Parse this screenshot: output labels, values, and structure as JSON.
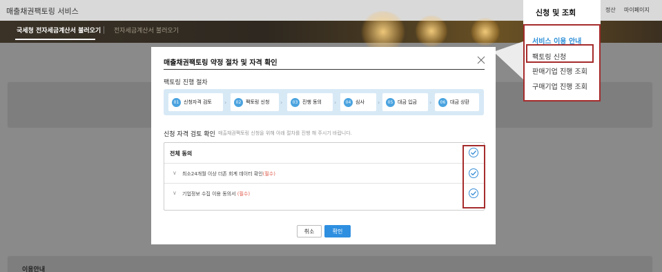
{
  "header": {
    "brand": "매출채권팩토링 서비스",
    "nav_settle": "정산",
    "nav_mypage": "마이페이지"
  },
  "banner": {
    "tab_active": "국세청 전자세금계산서 불러오기",
    "tab_inactive": "전자세금계산서 불러오기"
  },
  "background": {
    "info_title": "이용안내"
  },
  "menu": {
    "title": "신청 및 조회",
    "items": [
      {
        "label": "서비스 이용 안내"
      },
      {
        "label": "팩토링 신청"
      },
      {
        "label": "판매기업 진행 조회"
      },
      {
        "label": "구매기업 진행 조회"
      }
    ]
  },
  "modal": {
    "title": "매출채권팩토링 약정 절차 및 자격 확인",
    "process_label": "팩토링 진행 절차",
    "steps": [
      {
        "num": "01",
        "label": "신청자격 검토"
      },
      {
        "num": "02",
        "label": "팩토링 신청"
      },
      {
        "num": "03",
        "label": "진행 동의"
      },
      {
        "num": "04",
        "label": "심사"
      },
      {
        "num": "05",
        "label": "대금 입금"
      },
      {
        "num": "06",
        "label": "대금 상환"
      }
    ],
    "check_title": "신청 자격 검토 확인",
    "check_sub": "매출채권팩토링 신청을 위해 아래 절차를 진행 해 주시기 바랍니다.",
    "agree_all": "전체 동의",
    "agree_items": [
      {
        "label": "최소24개월 이상 더존 회계 데이터 확인",
        "required": "(필수)"
      },
      {
        "label": "기업정보 수집 이용 동의서",
        "required": "(필수)"
      }
    ],
    "cancel_label": "취소",
    "ok_label": "확인"
  },
  "colors": {
    "accent": "#2e8fe0",
    "highlight_border": "#a52a2a",
    "required": "#e05a4a",
    "steps_bg": "#d8e9f6"
  }
}
